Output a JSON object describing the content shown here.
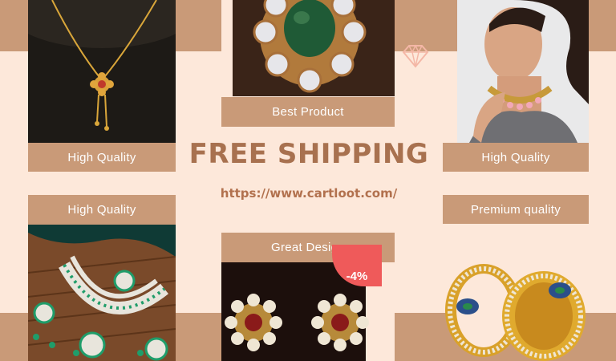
{
  "labels": {
    "top_left": "High Quality",
    "top_center": "Best Product",
    "top_right": "High Quality",
    "bottom_left": "High Quality",
    "bottom_center": "Great Design",
    "bottom_right": "Premium quality"
  },
  "headline": "FREE SHIPPING",
  "url": "https://www.cartloot.com/",
  "discount_badge": "-4%",
  "colors": {
    "background": "#fde8da",
    "accent": "#c99a78",
    "headline": "#a8714f",
    "badge": "#ef5a5a"
  },
  "icons": [
    "diamond-icon"
  ]
}
